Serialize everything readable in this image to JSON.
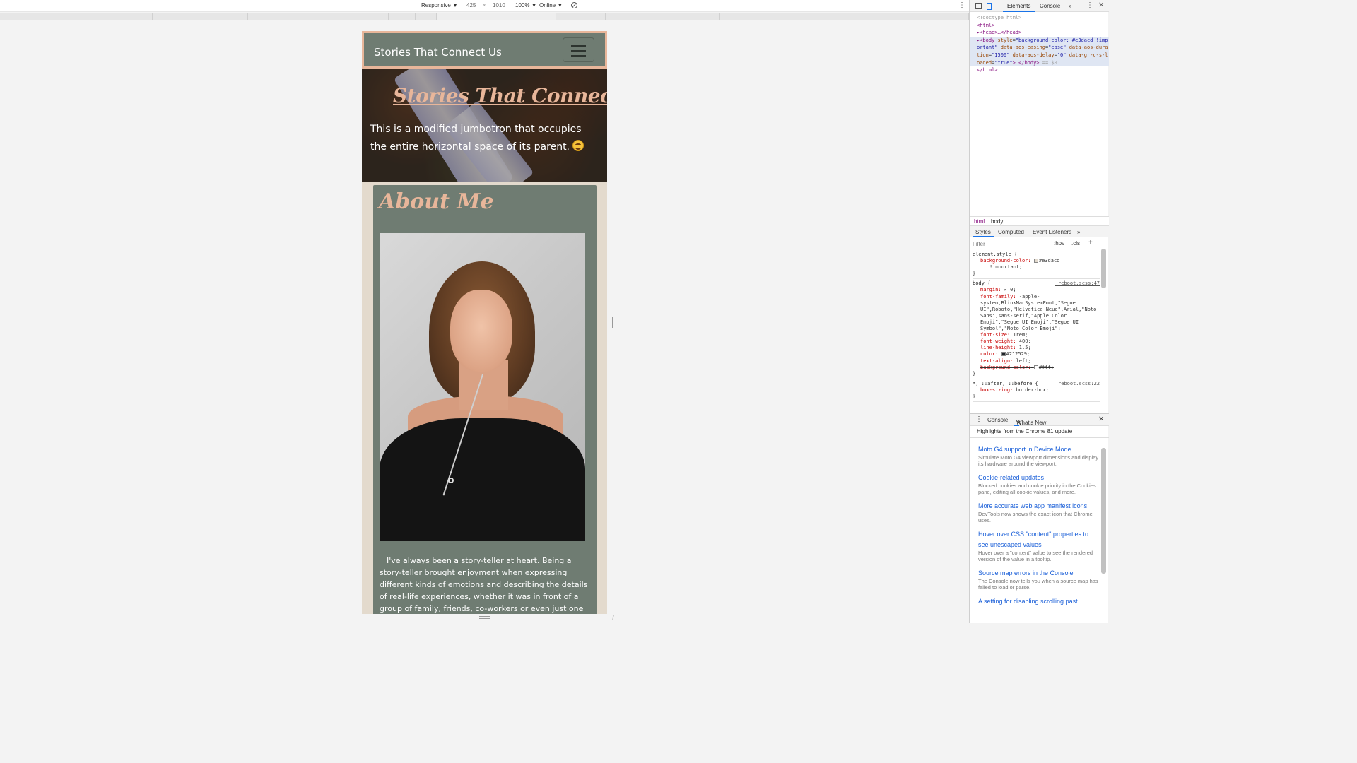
{
  "device_toolbar": {
    "device": "Responsive ▼",
    "width": "425",
    "times": "×",
    "height": "1010",
    "zoom": "100% ▼",
    "network": "Online ▼"
  },
  "site": {
    "brand": "Stories That Connect Us",
    "jumbotron_title": "Stories That Connect Us",
    "jumbotron_lead": "This is a modified jumbotron that occupies the entire horizontal space of its parent.",
    "about_title": "About Me",
    "about_text": "I've always been a story-teller at heart. Being a story-teller brought enjoyment when expressing different kinds of emotions and describing the details of real-life experiences, whether it was in front of a group of family, friends, co-workers or even just one on one in an",
    "colors": {
      "page_bg": "#e3dacd",
      "accent": "#e8b69a",
      "card": "#6f7c72"
    }
  },
  "devtools": {
    "tabs": [
      "Elements",
      "Console",
      "»"
    ],
    "dom": {
      "doctype": "<!doctype html>",
      "html_open": "<html>",
      "head": "<head>…</head>",
      "body_tag": "<body",
      "body_style_attr": "style",
      "body_style_val": "\"background-color: #e3dacd !important\"",
      "body_easing_attr": "data-aos-easing",
      "body_easing_val": "\"ease\"",
      "body_duration_attr": "data-aos-duration",
      "body_duration_val": "\"1500\"",
      "body_delay_attr": "data-aos-delay",
      "body_delay_val": "\"0\"",
      "body_loaded_attr": "data-gr-c-s-loaded",
      "body_loaded_val": "\"true\"",
      "body_close": ">…</body>",
      "body_eq": "== $0",
      "html_close": "</html>"
    },
    "breadcrumbs": [
      "html",
      "body"
    ],
    "styles_tabs": [
      "Styles",
      "Computed",
      "Event Listeners",
      "»"
    ],
    "filter_placeholder": "Filter",
    "hov": ":hov",
    "cls": ".cls",
    "plus": "+",
    "styles": {
      "element_style": "element.style {",
      "bg_color_prop": "background-color:",
      "bg_color_val": "#e3dacd",
      "important": "!important;",
      "close": "}",
      "body_sel": "body {",
      "body_src": "_reboot.scss:47",
      "margin_prop": "margin:",
      "margin_val": "▸ 0;",
      "font_family_prop": "font-family:",
      "font_family_val": "-apple-system,BlinkMacSystemFont,\"Segoe UI\",Roboto,\"Helvetica Neue\",Arial,\"Noto Sans\",sans-serif,\"Apple Color Emoji\",\"Segoe UI Emoji\",\"Segoe UI Symbol\",\"Noto Color Emoji\";",
      "font_size_prop": "font-size:",
      "font_size_val": "1rem;",
      "font_weight_prop": "font-weight:",
      "font_weight_val": "400;",
      "line_height_prop": "line-height:",
      "line_height_val": "1.5;",
      "color_prop": "color:",
      "color_val": "#212529;",
      "text_align_prop": "text-align:",
      "text_align_val": "left;",
      "bg_struck_prop": "background-color:",
      "bg_struck_val": "#fff;",
      "universal_sel": "*, ::after, ::before {",
      "universal_src": "_reboot.scss:22",
      "box_sizing_prop": "box-sizing:",
      "box_sizing_val": "border-box;"
    },
    "drawer_tabs": [
      "Console",
      "What's New"
    ],
    "whatsnew_header": "Highlights from the Chrome 81 update",
    "whatsnew_items": [
      {
        "title": "Moto G4 support in Device Mode",
        "desc": "Simulate Moto G4 viewport dimensions and display its hardware around the viewport."
      },
      {
        "title": "Cookie-related updates",
        "desc": "Blocked cookies and cookie priority in the Cookies pane, editing all cookie values, and more."
      },
      {
        "title": "More accurate web app manifest icons",
        "desc": "DevTools now shows the exact icon that Chrome uses."
      },
      {
        "title": "Hover over CSS \"content\" properties to see unescaped values",
        "desc": "Hover over a \"content\" value to see the rendered version of the value in a tooltip."
      },
      {
        "title": "Source map errors in the Console",
        "desc": "The Console now tells you when a source map has failed to load or parse."
      },
      {
        "title": "A setting for disabling scrolling past",
        "desc": ""
      }
    ]
  }
}
